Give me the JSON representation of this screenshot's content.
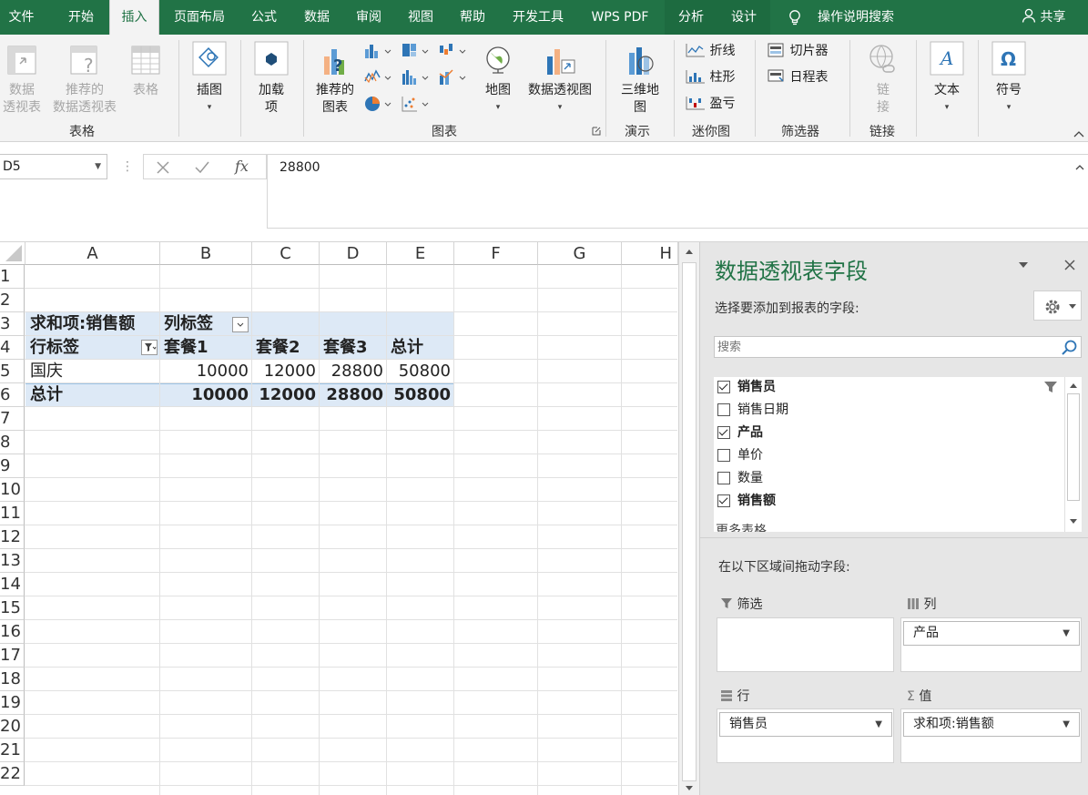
{
  "tabs": [
    {
      "label": "文件",
      "active": false
    },
    {
      "label": "开始",
      "active": false
    },
    {
      "label": "插入",
      "active": true
    },
    {
      "label": "页面布局",
      "active": false
    },
    {
      "label": "公式",
      "active": false
    },
    {
      "label": "数据",
      "active": false
    },
    {
      "label": "审阅",
      "active": false
    },
    {
      "label": "视图",
      "active": false
    },
    {
      "label": "帮助",
      "active": false
    },
    {
      "label": "开发工具",
      "active": false
    },
    {
      "label": "WPS PDF",
      "active": false
    },
    {
      "label": "分析",
      "active": false
    },
    {
      "label": "设计",
      "active": false
    }
  ],
  "tell_me": "操作说明搜索",
  "share": "共享",
  "ribbon": {
    "pivot_table": [
      "数据",
      "透视表"
    ],
    "recommended_pivot": [
      "推荐的",
      "数据透视表"
    ],
    "table": "表格",
    "illustrations": "插图",
    "addins": [
      "加载",
      "项"
    ],
    "recommended_charts": [
      "推荐的",
      "图表"
    ],
    "map": "地图",
    "pivot_chart": "数据透视图",
    "map3d": [
      "三维地",
      "图"
    ],
    "spark_line": "折线",
    "spark_column": "柱形",
    "spark_winloss": "盈亏",
    "slicer": "切片器",
    "timeline": "日程表",
    "link": [
      "链",
      "接"
    ],
    "text": "文本",
    "symbol": "符号",
    "groups": {
      "tables": "表格",
      "charts": "图表",
      "tours": "演示",
      "sparklines": "迷你图",
      "filters": "筛选器",
      "links": "链接"
    }
  },
  "formula_bar": {
    "name_box": "D5",
    "formula": "28800"
  },
  "sheet": {
    "columns": [
      "A",
      "B",
      "C",
      "D",
      "E",
      "F",
      "G",
      "H"
    ],
    "rows": [
      "1",
      "2",
      "3",
      "4",
      "5",
      "6",
      "7",
      "8",
      "9",
      "10",
      "11",
      "12",
      "13",
      "14",
      "15",
      "16",
      "17",
      "18",
      "19",
      "20",
      "21",
      "22"
    ],
    "pivot": {
      "sum_label": "求和项:销售额",
      "col_label": "列标签",
      "row_label": "行标签",
      "col_headers": [
        "套餐1",
        "套餐2",
        "套餐3",
        "总计"
      ],
      "rows": [
        {
          "label": "国庆",
          "values": [
            "10000",
            "12000",
            "28800",
            "50800"
          ]
        }
      ],
      "total_label": "总计",
      "totals": [
        "10000",
        "12000",
        "28800",
        "50800"
      ]
    }
  },
  "pane": {
    "title": "数据透视表字段",
    "choose_fields": "选择要添加到报表的字段:",
    "search_placeholder": "搜索",
    "fields": [
      {
        "label": "销售员",
        "checked": true
      },
      {
        "label": "销售日期",
        "checked": false
      },
      {
        "label": "产品",
        "checked": true
      },
      {
        "label": "单价",
        "checked": false
      },
      {
        "label": "数量",
        "checked": false
      },
      {
        "label": "销售额",
        "checked": true
      }
    ],
    "more_tables": "更多表格...",
    "drag_hint": "在以下区域间拖动字段:",
    "filter_area": "筛选",
    "columns_area": "列",
    "rows_area": "行",
    "values_area": "值",
    "columns_item": "产品",
    "rows_item": "销售员",
    "values_item": "求和项:销售额"
  },
  "colors": {
    "accent": "#217346",
    "pivot_band": "#dde9f6"
  }
}
